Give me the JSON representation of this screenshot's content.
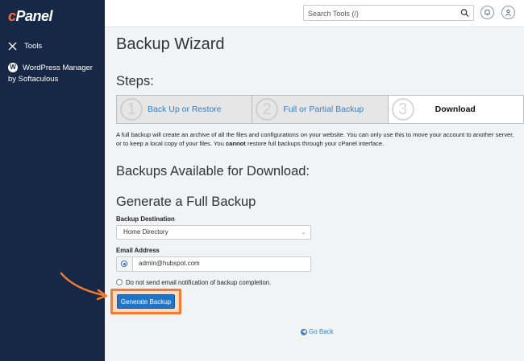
{
  "sidebar": {
    "logo": "cPanel",
    "items": [
      {
        "label": "Tools",
        "icon": "tools-icon"
      },
      {
        "label": "WordPress Manager by Softaculous",
        "icon": "wordpress-icon"
      }
    ]
  },
  "topbar": {
    "search_placeholder": "Search Tools (/)",
    "icons": [
      "search-icon",
      "bell-icon",
      "user-icon"
    ]
  },
  "main": {
    "title": "Backup Wizard",
    "steps_heading": "Steps:",
    "steps": [
      {
        "number": "1",
        "label": "Back Up or Restore",
        "active": false
      },
      {
        "number": "2",
        "label": "Full or Partial Backup",
        "active": false
      },
      {
        "number": "3",
        "label": "Download",
        "active": true
      }
    ],
    "description_part1": "A full backup will create an archive of all the files and configurations on your website. You can only use this to move your account to another server, or to keep a local copy of your files. You ",
    "description_bold": "cannot",
    "description_part2": " restore full backups through your cPanel interface.",
    "backups_heading": "Backups Available for Download:",
    "generate_heading": "Generate a Full Backup",
    "destination_label": "Backup Destination",
    "destination_value": "Home Directory",
    "email_label": "Email Address",
    "email_value": "admin@hubspot.com",
    "no_notify_label": "Do not send email notification of backup completion.",
    "generate_button": "Generate Backup",
    "go_back": "Go Back"
  },
  "colors": {
    "sidebar_bg": "#162845",
    "accent": "#ff6c2c",
    "button_blue": "#1e74c7",
    "highlight_orange": "#f57c2e"
  }
}
